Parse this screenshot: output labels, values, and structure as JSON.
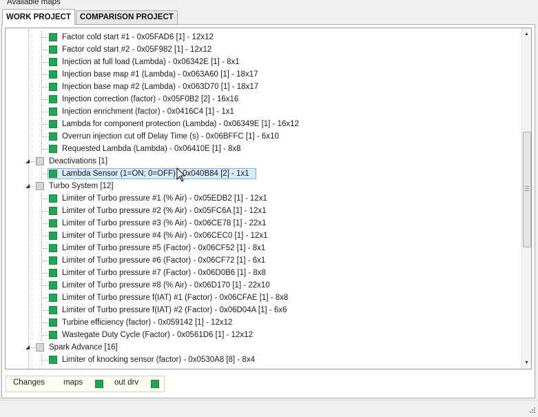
{
  "panel_title": "Available maps",
  "tabs": [
    {
      "label": "WORK PROJECT",
      "active": true
    },
    {
      "label": "COMPARISON PROJECT",
      "active": false
    }
  ],
  "tree": [
    {
      "level": 2,
      "icon": "green-map-square-icon",
      "label": "Factor cold start #1 - 0x05FAD6 [1] - 12x12"
    },
    {
      "level": 2,
      "icon": "green-map-square-icon",
      "label": "Factor cold start #2 - 0x05F982 [1] - 12x12"
    },
    {
      "level": 2,
      "icon": "green-map-square-icon",
      "label": "Injection at full load (Lambda) - 0x06342E [1] - 8x1"
    },
    {
      "level": 2,
      "icon": "green-map-square-icon",
      "label": "Injection base map #1 (Lambda) - 0x063A60 [1] - 18x17"
    },
    {
      "level": 2,
      "icon": "green-map-square-icon",
      "label": "Injection base map #2 (Lambda) - 0x063D70 [1] - 18x17"
    },
    {
      "level": 2,
      "icon": "green-map-square-icon",
      "label": "Injection correction (factor) - 0x05F0B2 [2] - 16x16"
    },
    {
      "level": 2,
      "icon": "green-map-square-icon",
      "label": "Injection enrichment (factor) - 0x0416C4 [1] - 1x1"
    },
    {
      "level": 2,
      "icon": "green-map-square-icon",
      "label": "Lambda for component protection (Lambda) - 0x06349E [1] - 16x12"
    },
    {
      "level": 2,
      "icon": "green-map-square-icon",
      "label": "Overrun injection cut off Delay Time (s) - 0x06BFFC [1] - 6x10"
    },
    {
      "level": 2,
      "icon": "green-map-square-icon",
      "label": "Requested Lambda (Lambda) - 0x06410E [1] - 8x8"
    },
    {
      "level": 1,
      "icon": "gray-folder-square-icon",
      "label": "Deactivations [1]",
      "expander": "◢"
    },
    {
      "level": 2,
      "icon": "green-map-square-icon",
      "label": "Lambda Sensor (1=ON; 0=OFF) - 0x040B84 [2] - 1x1",
      "selected": true
    },
    {
      "level": 1,
      "icon": "gray-folder-square-icon",
      "label": "Turbo System [12]",
      "expander": "◢"
    },
    {
      "level": 2,
      "icon": "green-map-square-icon",
      "label": "Limiter of Turbo pressure #1 (% Air) - 0x05EDB2 [1] - 12x1"
    },
    {
      "level": 2,
      "icon": "green-map-square-icon",
      "label": "Limiter of Turbo pressure #2 (% Air) - 0x05FC6A [1] - 12x1"
    },
    {
      "level": 2,
      "icon": "green-map-square-icon",
      "label": "Limiter of Turbo pressure #3 (% Air) - 0x06CE78 [1] - 22x1"
    },
    {
      "level": 2,
      "icon": "green-map-square-icon",
      "label": "Limiter of Turbo pressure #4 (% Air) - 0x06CEC0 [1] - 12x1"
    },
    {
      "level": 2,
      "icon": "green-map-square-icon",
      "label": "Limiter of Turbo pressure #5 (Factor) - 0x06CF52 [1] - 8x1"
    },
    {
      "level": 2,
      "icon": "green-map-square-icon",
      "label": "Limiter of Turbo pressure #6 (Factor) - 0x06CF72 [1] - 6x1"
    },
    {
      "level": 2,
      "icon": "green-map-square-icon",
      "label": "Limiter of Turbo pressure #7 (Factor) - 0x06D0B6 [1] - 8x8"
    },
    {
      "level": 2,
      "icon": "green-map-square-icon",
      "label": "Limiter of Turbo pressure #8 (% Air) - 0x06D170 [1] - 22x10"
    },
    {
      "level": 2,
      "icon": "green-map-square-icon",
      "label": "Limiter of Turbo pressure f(IAT) #1 (Factor) - 0x06CFAE [1] - 8x8"
    },
    {
      "level": 2,
      "icon": "green-map-square-icon",
      "label": "Limiter of Turbo pressure f(IAT) #2 (Factor) - 0x06D04A [1] - 6x6"
    },
    {
      "level": 2,
      "icon": "green-map-square-icon",
      "label": "Turbine efficiency (factor) - 0x059142 [1] - 12x12"
    },
    {
      "level": 2,
      "icon": "green-map-square-icon",
      "label": "Wastegate Duty Cycle (Factor) - 0x0561D6 [1] - 12x12"
    },
    {
      "level": 1,
      "icon": "gray-folder-square-icon",
      "label": "Spark Advance [16]",
      "expander": "◢"
    },
    {
      "level": 2,
      "icon": "green-map-square-icon",
      "label": "Limiter of knocking sensor (factor) - 0x0530A8 [8] - 8x4"
    }
  ],
  "legend": {
    "changes_label": "Changes",
    "maps_label": "maps",
    "outdrv_label": "out drv"
  },
  "colors": {
    "map_green": "#22a655",
    "folder_gray": "#d6d6d6",
    "selection": "#dbeaf8"
  }
}
